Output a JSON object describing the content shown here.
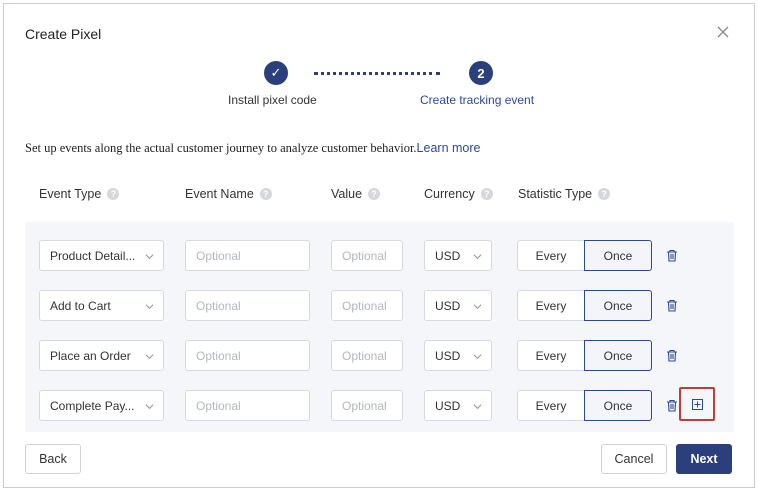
{
  "dialog": {
    "title": "Create Pixel"
  },
  "stepper": {
    "steps": [
      {
        "label": "Install pixel code",
        "marker": "✓"
      },
      {
        "label": "Create tracking event",
        "marker": "2"
      }
    ]
  },
  "intro": {
    "text": "Set up events along the actual customer journey to analyze customer behavior.",
    "link": "Learn more"
  },
  "columns": [
    "Event Type",
    "Event Name",
    "Value",
    "Currency",
    "Statistic Type"
  ],
  "help_glyph": "?",
  "rows": [
    {
      "event_type": "Product Detail...",
      "event_name_placeholder": "Optional",
      "value_placeholder": "Optional",
      "currency": "USD",
      "stat_every": "Every",
      "stat_once": "Once"
    },
    {
      "event_type": "Add to Cart",
      "event_name_placeholder": "Optional",
      "value_placeholder": "Optional",
      "currency": "USD",
      "stat_every": "Every",
      "stat_once": "Once"
    },
    {
      "event_type": "Place an Order",
      "event_name_placeholder": "Optional",
      "value_placeholder": "Optional",
      "currency": "USD",
      "stat_every": "Every",
      "stat_once": "Once"
    },
    {
      "event_type": "Complete Pay...",
      "event_name_placeholder": "Optional",
      "value_placeholder": "Optional",
      "currency": "USD",
      "stat_every": "Every",
      "stat_once": "Once"
    }
  ],
  "footer": {
    "back": "Back",
    "cancel": "Cancel",
    "next": "Next"
  },
  "colors": {
    "primary": "#2b3f7d",
    "link": "#2b4a96",
    "highlight": "#c23a3a",
    "panel": "#f4f6f9"
  }
}
